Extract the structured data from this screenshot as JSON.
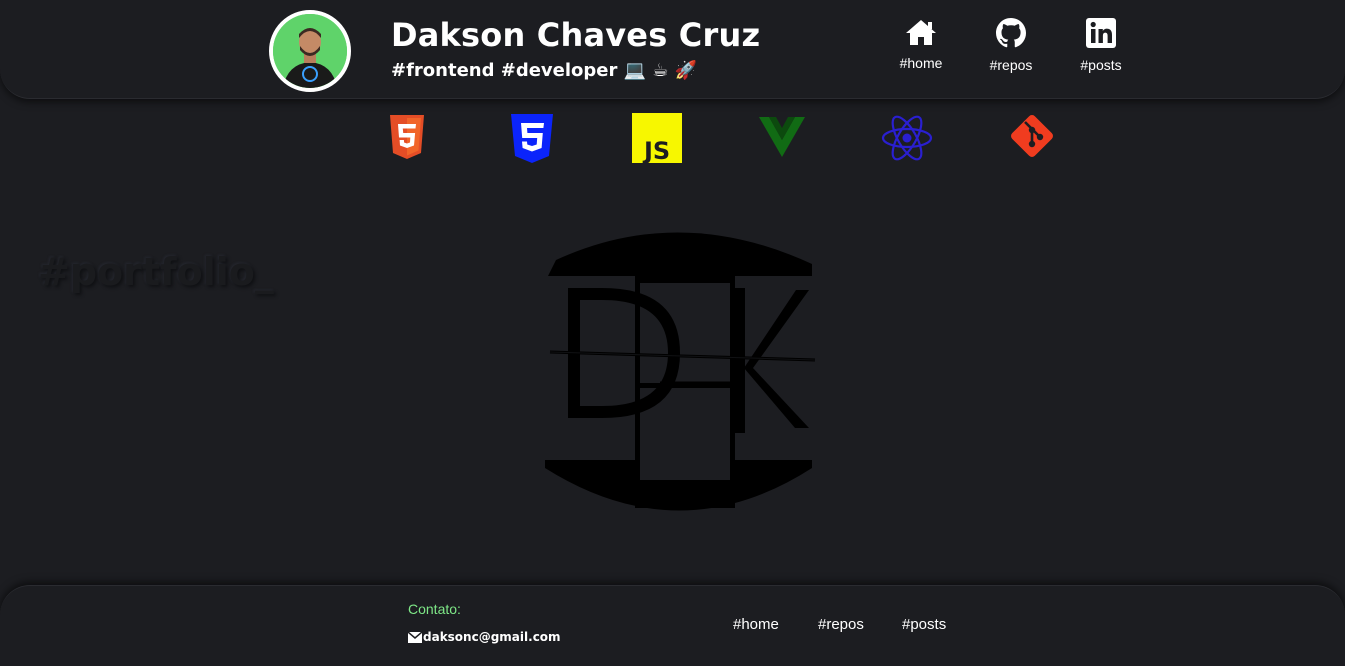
{
  "header": {
    "name": "Dakson Chaves Cruz",
    "tagline": "#frontend #developer 💻 ☕ 🚀",
    "nav": [
      {
        "label": "#home",
        "icon": "home-icon"
      },
      {
        "label": "#repos",
        "icon": "github-icon"
      },
      {
        "label": "#posts",
        "icon": "linkedin-icon"
      }
    ]
  },
  "tech_icons": [
    {
      "icon": "html5-icon",
      "color": "#e44d26"
    },
    {
      "icon": "css3-icon",
      "color": "#0b24fb"
    },
    {
      "icon": "javascript-icon",
      "color": "#f7f700",
      "text": "JS"
    },
    {
      "icon": "vue-icon",
      "color": "#116b14"
    },
    {
      "icon": "react-icon",
      "color": "#2a1fd0"
    },
    {
      "icon": "git-icon",
      "color": "#f03c1f"
    }
  ],
  "main": {
    "watermark": "#portfolio_",
    "logo_letters": [
      "D",
      "K"
    ]
  },
  "footer": {
    "contact_label": "Contato:",
    "email": "daksonc@gmail.com",
    "links": [
      "#home",
      "#repos",
      "#posts"
    ]
  }
}
